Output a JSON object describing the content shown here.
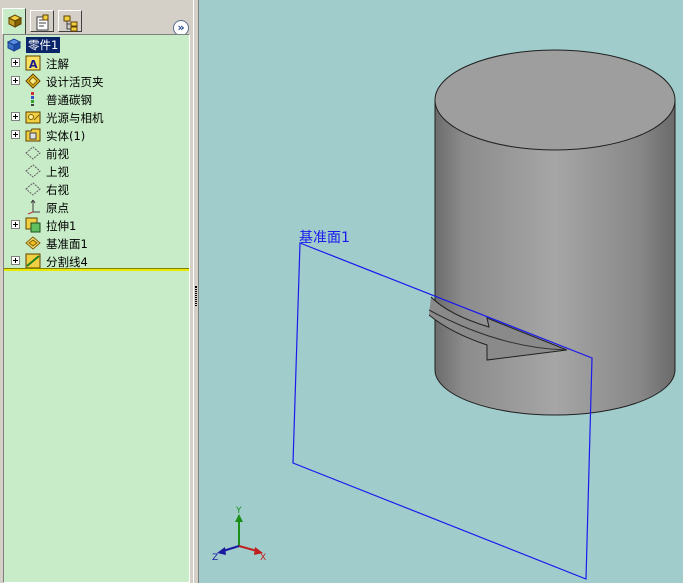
{
  "feature_tree": {
    "root": {
      "label": "零件1",
      "icon": "part-icon"
    },
    "items": [
      {
        "label": "注解",
        "icon": "annotations-icon",
        "expandable": true
      },
      {
        "label": "设计活页夹",
        "icon": "design-binder-icon",
        "expandable": true
      },
      {
        "label": "普通碳钢",
        "icon": "material-icon",
        "expandable": false
      },
      {
        "label": "光源与相机",
        "icon": "lights-cameras-icon",
        "expandable": true
      },
      {
        "label": "实体(1)",
        "icon": "solid-bodies-icon",
        "expandable": true
      },
      {
        "label": "前视",
        "icon": "plane-icon",
        "expandable": false
      },
      {
        "label": "上视",
        "icon": "plane-icon",
        "expandable": false
      },
      {
        "label": "右视",
        "icon": "plane-icon",
        "expandable": false
      },
      {
        "label": "原点",
        "icon": "origin-icon",
        "expandable": false
      },
      {
        "label": "拉伸1",
        "icon": "extrude-icon",
        "expandable": true
      },
      {
        "label": "基准面1",
        "icon": "ref-plane-icon",
        "expandable": false
      },
      {
        "label": "分割线4",
        "icon": "split-line-icon",
        "expandable": true
      }
    ]
  },
  "tabs": [
    {
      "name": "featuremanager-tab",
      "icon": "feature-tree-icon",
      "active": true
    },
    {
      "name": "propertymanager-tab",
      "icon": "property-icon",
      "active": false
    },
    {
      "name": "configurationmanager-tab",
      "icon": "configuration-icon",
      "active": false
    }
  ],
  "collapse_button": {
    "label": "»"
  },
  "viewport": {
    "plane_label": "基准面1",
    "background_color": "#a1cccc",
    "plane_color": "#1a1aee",
    "triad": {
      "x": "X",
      "y": "Y",
      "z": "Z"
    }
  },
  "colors": {
    "tree_background": "#c8ecc8",
    "selection": "#0a246a",
    "rollback_bar": "#e8e800"
  }
}
